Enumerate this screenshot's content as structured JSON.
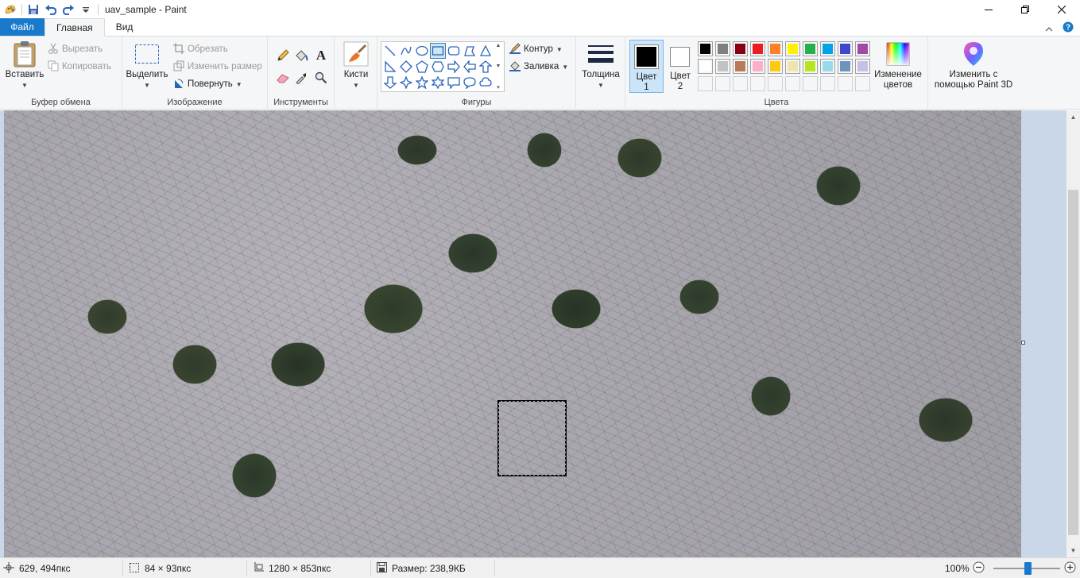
{
  "window": {
    "title": "uav_sample - Paint"
  },
  "tabs": {
    "file": "Файл",
    "home": "Главная",
    "view": "Вид"
  },
  "clipboard": {
    "paste": "Вставить",
    "cut": "Вырезать",
    "copy": "Копировать",
    "label": "Буфер обмена"
  },
  "image": {
    "select": "Выделить",
    "crop": "Обрезать",
    "resize": "Изменить размер",
    "rotate": "Повернуть",
    "label": "Изображение"
  },
  "tools": {
    "label": "Инструменты"
  },
  "brushes": {
    "label": "Кисти"
  },
  "shapes": {
    "outline": "Контур",
    "fill": "Заливка",
    "label": "Фигуры"
  },
  "size": {
    "label": "Толщина"
  },
  "colors": {
    "color1_line1": "Цвет",
    "color1_line2": "1",
    "color2_line1": "Цвет",
    "color2_line2": "2",
    "edit_line1": "Изменение",
    "edit_line2": "цветов",
    "label": "Цвета",
    "color1": "#000000",
    "color2": "#ffffff",
    "palette_row1": [
      "#000000",
      "#7f7f7f",
      "#880015",
      "#ed1c24",
      "#ff7f27",
      "#fff200",
      "#22b14c",
      "#00a2e8",
      "#3f48cc",
      "#a349a4"
    ],
    "palette_row2": [
      "#ffffff",
      "#c3c3c3",
      "#b97a57",
      "#ffaec9",
      "#ffc90e",
      "#efe4b0",
      "#b5e61d",
      "#99d9ea",
      "#7092be",
      "#c8bfe7"
    ],
    "palette_row3": [
      "#f5f6f7",
      "#f5f6f7",
      "#f5f6f7",
      "#f5f6f7",
      "#f5f6f7",
      "#f5f6f7",
      "#f5f6f7",
      "#f5f6f7",
      "#f5f6f7",
      "#f5f6f7"
    ]
  },
  "paint3d": {
    "line1": "Изменить с",
    "line2": "помощью Paint 3D"
  },
  "status": {
    "cursor": "629, 494пкс",
    "selection": "84 × 93пкс",
    "image_size": "1280 × 853пкс",
    "file_size": "Размер: 238,9КБ",
    "zoom": "100%"
  }
}
